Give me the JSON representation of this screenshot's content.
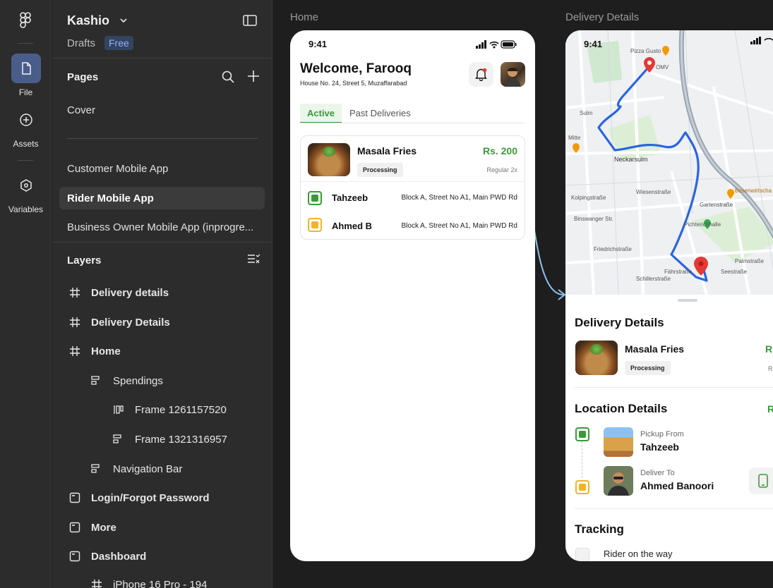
{
  "rail": {
    "tools": [
      {
        "label": "File",
        "icon": "file-icon"
      },
      {
        "label": "Assets",
        "icon": "plus-circle-icon"
      },
      {
        "label": "Variables",
        "icon": "hexagon-icon"
      }
    ]
  },
  "project": {
    "name": "Kashio",
    "drafts": "Drafts",
    "plan": "Free"
  },
  "pages": {
    "title": "Pages",
    "items": [
      "Cover",
      "Customer Mobile App",
      "Rider Mobile App",
      "Business Owner Mobile App (inprogre..."
    ],
    "selected": "Rider Mobile App"
  },
  "layers": {
    "title": "Layers",
    "items": [
      {
        "label": "Delivery details",
        "icon": "frame-icon"
      },
      {
        "label": "Delivery Details",
        "icon": "frame-icon"
      },
      {
        "label": "Home",
        "icon": "frame-icon"
      },
      {
        "label": "Spendings",
        "icon": "auto-layout-icon"
      },
      {
        "label": "Frame 1261157520",
        "icon": "auto-layout-horizontal-icon"
      },
      {
        "label": "Frame 1321316957",
        "icon": "auto-layout-icon"
      },
      {
        "label": "Navigation Bar",
        "icon": "auto-layout-icon"
      },
      {
        "label": "Login/Forgot Password",
        "icon": "section-icon"
      },
      {
        "label": "More",
        "icon": "section-icon"
      },
      {
        "label": "Dashboard",
        "icon": "section-icon"
      },
      {
        "label": "iPhone 16 Pro - 194",
        "icon": "frame-icon"
      }
    ]
  },
  "canvas": {
    "frames": [
      "Home",
      "Delivery Details"
    ]
  },
  "home": {
    "time": "9:41",
    "welcome": "Welcome, Farooq",
    "address": "House No. 24, Street 5, Muzaffarabad",
    "tabs": [
      "Active",
      "Past Deliveries"
    ],
    "order": {
      "name": "Masala Fries",
      "price": "Rs. 200",
      "status": "Processing",
      "size": "Regular 2x",
      "stops": [
        {
          "name": "Tahzeeb",
          "address": "Block A, Street No A1, Main PWD Rd"
        },
        {
          "name": "Ahmed B",
          "address": "Block A, Street No A1, Main PWD Rd"
        }
      ]
    }
  },
  "detail": {
    "time": "9:41",
    "map_labels": [
      "Pizza Gusto",
      "OMV",
      "Neckarsulm",
      "Pichterichhalle",
      "Besenwirtscha Benz\" - Neckar",
      "Binswanger Str.",
      "Friedrichstraße",
      "Mitte",
      "Sulm",
      "Kolpingstraße",
      "Wiesenstraße",
      "Fährstraße",
      "Seestraße",
      "Gartenstraße",
      "Palmstraße",
      "Schillerstraße"
    ],
    "section_delivery": "Delivery Details",
    "item_name": "Masala Fries",
    "item_price_partial": "Rs",
    "item_status": "Processing",
    "item_size_partial": "R",
    "section_location": "Location Details",
    "location_partial": "R",
    "pickup_caption": "Pickup From",
    "pickup_name": "Tahzeeb",
    "deliver_caption": "Deliver To",
    "deliver_name": "Ahmed Banoori",
    "section_tracking": "Tracking",
    "tracking_step": "Rider on the way"
  },
  "colors": {
    "accent_green": "#3a9a3a",
    "accent_yellow": "#f0b429",
    "route_blue": "#2a64e0",
    "selection_blue": "#4a5d8a"
  }
}
